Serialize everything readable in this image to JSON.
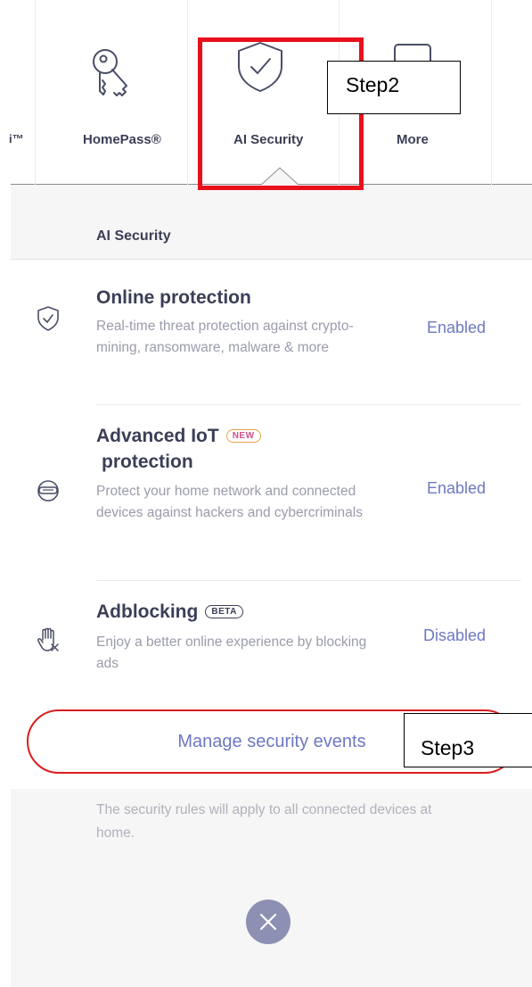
{
  "top_nav": {
    "tabs": [
      {
        "label": "i™",
        "icon": "wifi-icon"
      },
      {
        "label": "HomePass®",
        "icon": "keys-icon"
      },
      {
        "label": "AI Security",
        "icon": "shield-check-icon",
        "selected": true
      },
      {
        "label": "More",
        "icon": "more-icon"
      }
    ]
  },
  "section": {
    "title": "AI Security"
  },
  "features": [
    {
      "title": "Online protection",
      "badge": "",
      "description": "Real-time threat protection against crypto-mining, ransomware, malware & more",
      "status": "Enabled",
      "icon": "shield-check-icon"
    },
    {
      "title": "Advanced IoT",
      "title_line2": "protection",
      "badge": "NEW",
      "description": "Protect your home network and connected devices against hackers and cybercriminals",
      "status": "Enabled",
      "icon": "hacker-mask-icon"
    },
    {
      "title": "Adblocking",
      "badge": "BETA",
      "description": "Enjoy a better online experience by blocking ads",
      "status": "Disabled",
      "icon": "stop-hand-icon"
    }
  ],
  "manage_button": {
    "label": "Manage security events"
  },
  "footer": {
    "note": "The security rules will apply to all connected devices at home."
  },
  "annotations": {
    "step2": "Step2",
    "step3": "Step3"
  },
  "colors": {
    "accent": "#6d78c2",
    "text_dark": "#3b3f56",
    "text_muted": "#9a9caa",
    "annotation_red": "#e8101b",
    "panel_bg": "#f6f6f6"
  }
}
